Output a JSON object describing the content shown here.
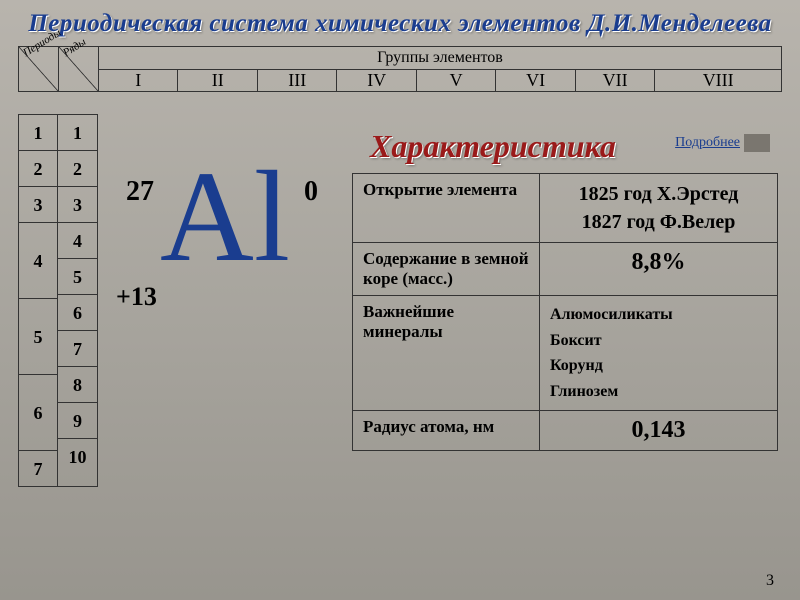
{
  "title": "Периодическая система химических элементов Д.И.Менделеева",
  "topbar": {
    "periods_label": "Периоды",
    "rows_label": "Ряды",
    "groups_title": "Группы элементов",
    "groups": [
      "I",
      "II",
      "III",
      "IV",
      "V",
      "VI",
      "VII",
      "VIII"
    ]
  },
  "periods_col": [
    "1",
    "2",
    "3",
    "4",
    "5",
    "6",
    "7"
  ],
  "rows_col": [
    "1",
    "2",
    "3",
    "4",
    "5",
    "6",
    "7",
    "8",
    "9",
    "10"
  ],
  "element": {
    "symbol": "Al",
    "mass": "27",
    "oxidation": "0",
    "charge": "+13"
  },
  "characteristic": {
    "title": "Характеристика",
    "more_link": "Подробнее"
  },
  "info": {
    "discovery": {
      "label": "Открытие элемента",
      "value_1": "1825 год Х.Эрстед",
      "value_2": "1827 год Ф.Велер"
    },
    "crust": {
      "label": "Содержание в земной коре (масс.)",
      "value": "8,8%"
    },
    "minerals": {
      "label": "Важнейшие минералы",
      "m1": "Алюмосиликаты",
      "m2": "Боксит",
      "m3": "Корунд",
      "m4": "Глинозем"
    },
    "radius": {
      "label": "Радиус атома, нм",
      "value": "0,143"
    }
  },
  "page_number": "3"
}
